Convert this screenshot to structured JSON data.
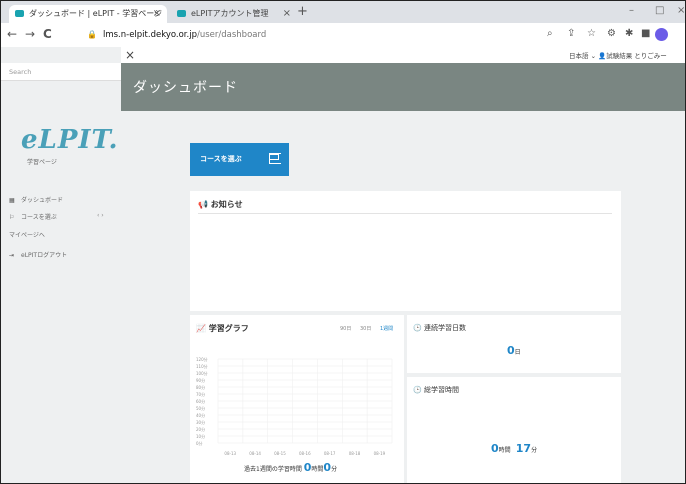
{
  "browser": {
    "tabs": [
      {
        "label": "ダッシュボード | eLPIT - 学習ページ",
        "active": true
      },
      {
        "label": "eLPITアカウント管理",
        "active": false
      }
    ],
    "new_tab": "+",
    "close": "×",
    "minimize": "–",
    "maximize": "□",
    "back": "←",
    "forward": "→",
    "reload": "C",
    "url_host": "lms.n-elpit.dekyo.or.jp",
    "url_path": "/user/dashboard"
  },
  "sidebar": {
    "search_placeholder": "Search",
    "logo_text": "eLPIT.",
    "logo_sub": "学習ページ",
    "items": [
      {
        "label": "ダッシュボード",
        "icon": "dashboard-icon"
      },
      {
        "label": "コースを選ぶ",
        "icon": "flag-icon"
      },
      {
        "label": "マイページへ",
        "icon": ""
      },
      {
        "label": "eLPITログアウト",
        "icon": "logout-icon"
      }
    ],
    "pager": "‹  ›"
  },
  "appbar": {
    "menu_icon": "×",
    "language": "日本語",
    "user": "試験結果 とりごみー"
  },
  "page": {
    "title": "ダッシュボード",
    "course_button": "コースを選ぶ"
  },
  "news": {
    "title": "お知らせ"
  },
  "graph": {
    "title": "学習グラフ",
    "ranges": [
      "90日",
      "30日",
      "1週間"
    ],
    "selected_range": "1週間",
    "summary_label": "過去1週間の学習時間",
    "summary_hours": "0",
    "summary_hours_unit": "時間",
    "summary_minutes": "0",
    "summary_minutes_unit": "分"
  },
  "chart_data": {
    "type": "bar",
    "categories": [
      "08-13",
      "08-14",
      "08-15",
      "08-16",
      "08-17",
      "08-18",
      "08-19"
    ],
    "values": [
      0,
      0,
      0,
      0,
      0,
      0,
      0
    ],
    "yticks": [
      "120分",
      "110分",
      "100分",
      "90分",
      "80分",
      "70分",
      "60分",
      "50分",
      "40分",
      "30分",
      "20分",
      "10分",
      "0分"
    ],
    "ylim": [
      0,
      120
    ],
    "grid": true
  },
  "streak": {
    "title": "連続学習日数",
    "value": "0",
    "unit": "日"
  },
  "total": {
    "title": "総学習時間",
    "hours": "0",
    "hours_unit": "時間",
    "minutes": "17",
    "minutes_unit": "分"
  },
  "colors": {
    "accent": "#1f86c8",
    "banner": "#7a8682",
    "logo": "#4aa0b8"
  }
}
